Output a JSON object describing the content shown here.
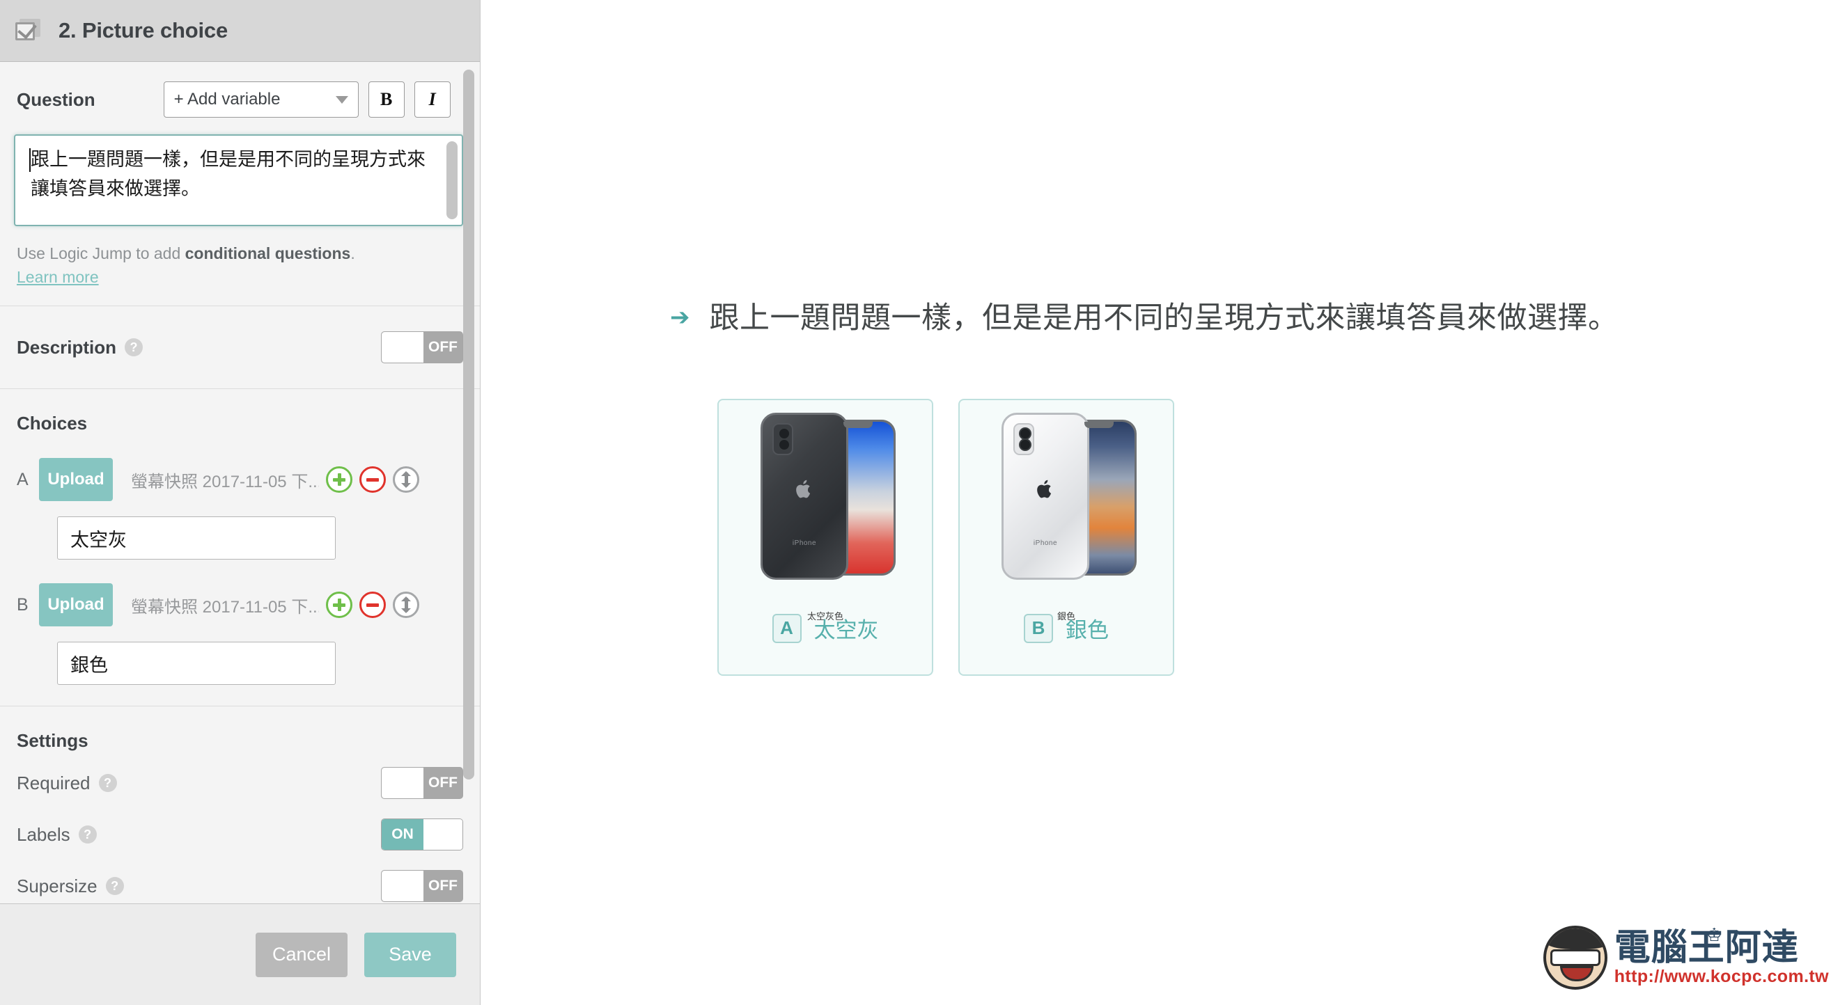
{
  "panel": {
    "title": "2. Picture choice",
    "type_icon": "picture-choice-icon"
  },
  "question": {
    "label": "Question",
    "add_variable_label": "+ Add variable",
    "bold_label": "B",
    "italic_label": "I",
    "value": "跟上一題問題一樣，但是是用不同的呈現方式來讓填答員來做選擇。",
    "hint_prefix": "Use Logic Jump to add ",
    "hint_bold": "conditional questions",
    "hint_suffix": ".",
    "learn_more": "Learn more"
  },
  "description": {
    "label": "Description",
    "help": "?",
    "toggle_state": "OFF"
  },
  "choices": {
    "title": "Choices",
    "items": [
      {
        "letter": "A",
        "upload_label": "Upload",
        "file_name": "螢幕快照 2017-11-05 下...",
        "text_value": "太空灰"
      },
      {
        "letter": "B",
        "upload_label": "Upload",
        "file_name": "螢幕快照 2017-11-05 下...",
        "text_value": "銀色"
      }
    ]
  },
  "settings": {
    "title": "Settings",
    "rows": [
      {
        "label": "Required",
        "help": "?",
        "state": "OFF"
      },
      {
        "label": "Labels",
        "help": "?",
        "state": "ON"
      },
      {
        "label": "Supersize",
        "help": "?",
        "state": "OFF"
      }
    ]
  },
  "footer": {
    "cancel_label": "Cancel",
    "save_label": "Save"
  },
  "preview": {
    "arrow": "➔",
    "question_text": "跟上一題問題一樣，但是是用不同的呈現方式來讓填答員來做選擇。",
    "cards": [
      {
        "badge": "A",
        "label": "太空灰",
        "image_caption": "太空灰色",
        "image_alt": "iphone-x-space-gray-photo",
        "phone_word": "iPhone"
      },
      {
        "badge": "B",
        "label": "銀色",
        "image_caption": "銀色",
        "image_alt": "iphone-x-silver-photo",
        "phone_word": "iPhone"
      }
    ]
  },
  "watermark": {
    "title": "電腦王阿達",
    "url": "http://www.kocpc.com.tw",
    "crown": "♔"
  },
  "colors": {
    "accent_teal": "#74bab5",
    "preview_teal": "#57b0ac",
    "card_border": "#bfe0de",
    "card_bg": "#f5fbfa",
    "sidebar_bg": "#f4f4f4",
    "header_bg": "#d7d7d7",
    "add_green": "#6fbf4a",
    "remove_red": "#e0332c"
  }
}
